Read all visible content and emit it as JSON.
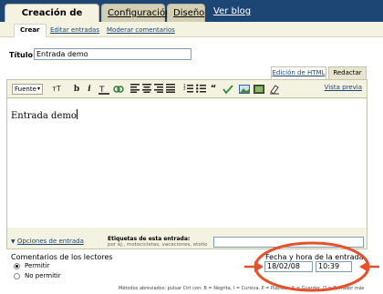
{
  "tabs": {
    "active": "Creación de entradas",
    "config": "Configuración",
    "design": "Diseño",
    "blog_link": "Ver blog"
  },
  "subnav": {
    "create": "Crear",
    "edit_posts": "Editar entradas",
    "moderate": "Moderar comentarios"
  },
  "post": {
    "title_label": "Título:",
    "title_value": "Entrada demo",
    "body_text": "Entrada demo"
  },
  "editor": {
    "mode_html": "Edición de HTML",
    "mode_compose": "Redactar",
    "font_select": "Fuente",
    "preview": "Vista previa",
    "toolbar_icons": [
      "font-size-icon",
      "bold-icon",
      "italic-icon",
      "text-color-icon",
      "link-icon",
      "align-left-icon",
      "align-center-icon",
      "align-right-icon",
      "justify-icon",
      "numbered-list-icon",
      "bullet-list-icon",
      "blockquote-icon",
      "spellcheck-icon",
      "image-icon",
      "video-icon",
      "eraser-icon"
    ]
  },
  "options": {
    "link": "Opciones de entrada",
    "labels_title": "Etiquetas de esta entrada:",
    "labels_hint": "por ej., motocicletas, vacaciones, otoño"
  },
  "comments": {
    "title": "Comentarios de los lectores",
    "allow": "Permitir",
    "deny": "No permitir",
    "selected": "allow"
  },
  "datetime": {
    "title": "Fecha y hora de la entrada",
    "date": "18/02/08",
    "time": "10:39"
  },
  "shortcuts": "Métodos abreviados: pulsar Ctrl con: B = Negrita, I = Cursiva, P = Publicar, S = Guardar, D = Borrador más",
  "colors": {
    "nav_bg": "#1d4675",
    "tab_bg": "#f4f2e0",
    "annotation": "#e8502a"
  }
}
